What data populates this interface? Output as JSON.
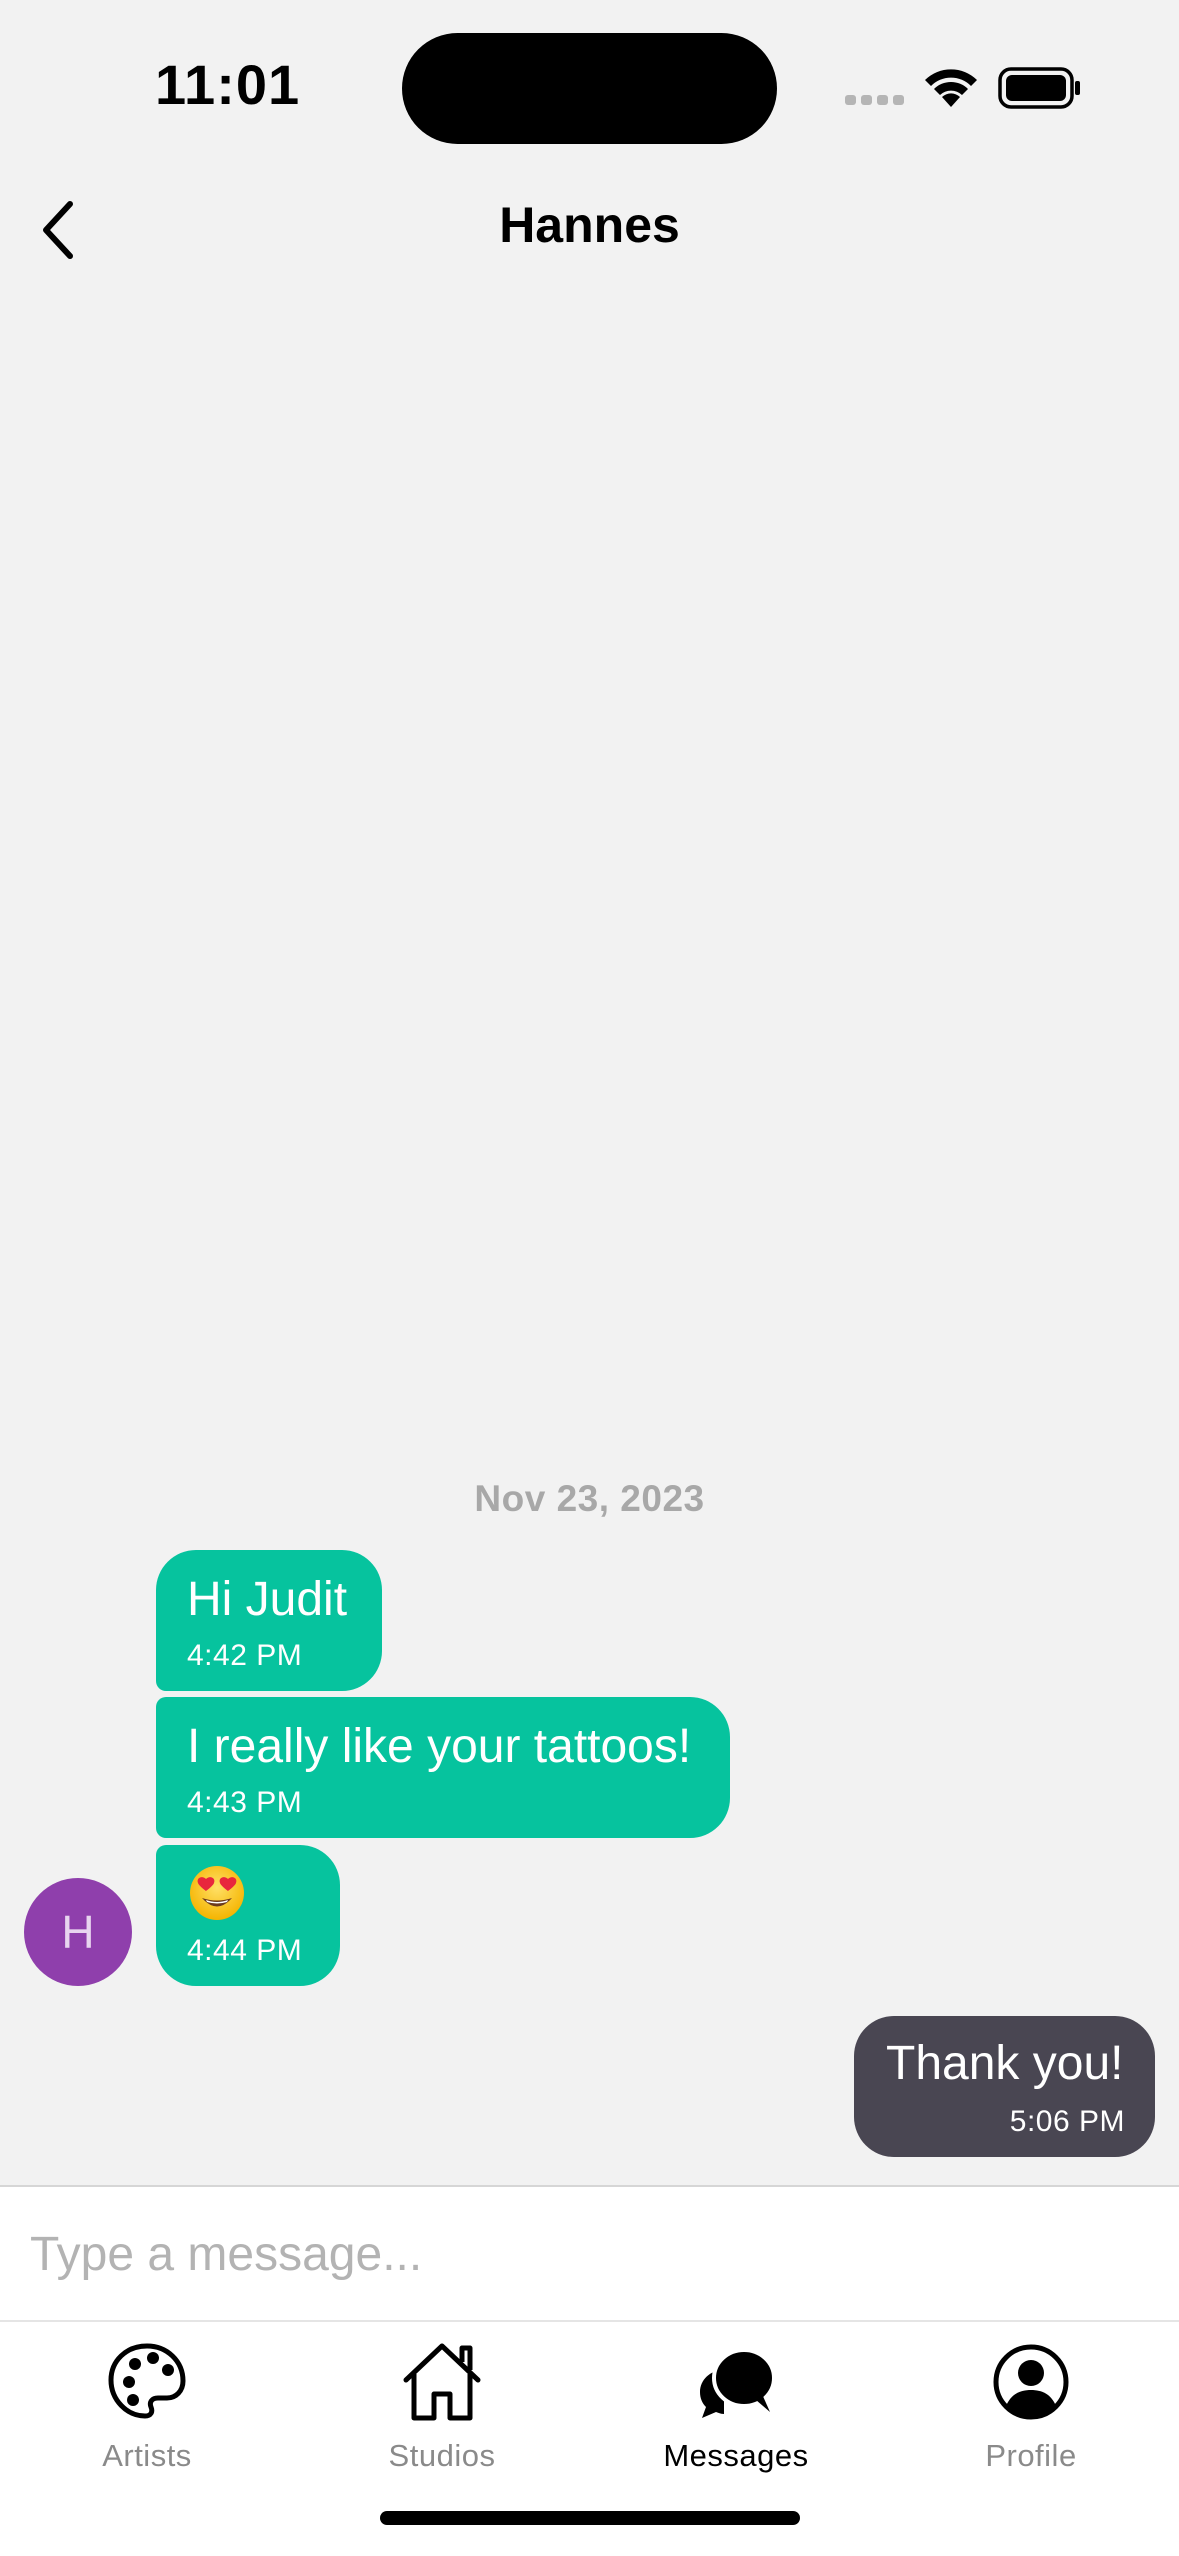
{
  "status_bar": {
    "time": "11:01"
  },
  "header": {
    "title": "Hannes"
  },
  "conversation": {
    "date_separator": "Nov 23, 2023",
    "contact_initial": "H",
    "messages": [
      {
        "from": "Hannes",
        "text": "Hi Judit",
        "time": "4:42 PM"
      },
      {
        "from": "Hannes",
        "text": "I really like your tattoos!",
        "time": "4:43 PM"
      },
      {
        "from": "Hannes",
        "text": "",
        "icon": "heart-eyes-emoji",
        "time": "4:44 PM"
      },
      {
        "from": "me",
        "text": "Thank you!",
        "time": "5:06 PM"
      }
    ]
  },
  "composer": {
    "placeholder": "Type a message...",
    "value": ""
  },
  "tabs": [
    {
      "label": "Artists",
      "icon": "palette-icon"
    },
    {
      "label": "Studios",
      "icon": "house-icon"
    },
    {
      "label": "Messages",
      "icon": "chat-bubbles-icon",
      "active": true
    },
    {
      "label": "Profile",
      "icon": "user-circle-icon"
    }
  ],
  "colors": {
    "background": "#f2f2f2",
    "incoming_bubble": "#06c39e",
    "outgoing_bubble": "#494652",
    "avatar": "#8f3fac",
    "inactive_tab": "#8a8a8a"
  }
}
